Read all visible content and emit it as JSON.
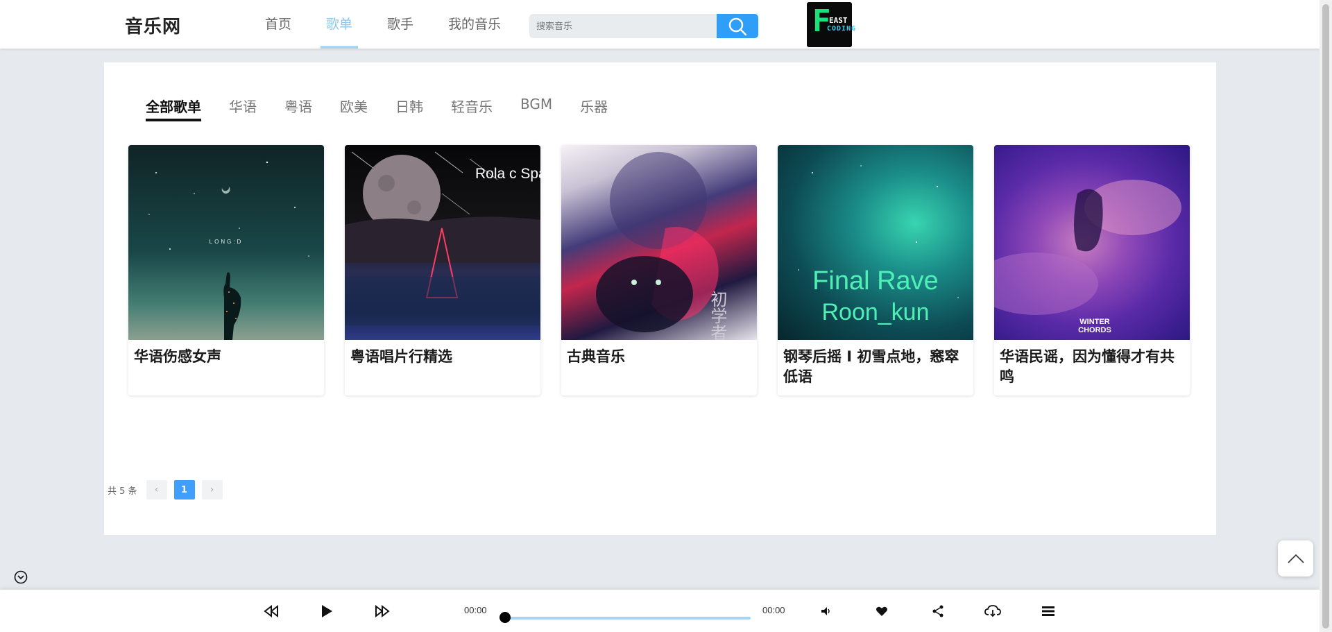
{
  "header": {
    "logo": "音乐网",
    "nav": [
      {
        "label": "首页"
      },
      {
        "label": "歌单",
        "active": true
      },
      {
        "label": "歌手"
      },
      {
        "label": "我的音乐"
      }
    ],
    "search_placeholder": "搜索音乐",
    "brand": {
      "f": "F",
      "east": "EAST",
      "coding": "CODING"
    }
  },
  "categories": [
    {
      "label": "全部歌单",
      "active": true
    },
    {
      "label": "华语"
    },
    {
      "label": "粤语"
    },
    {
      "label": "欧美"
    },
    {
      "label": "日韩"
    },
    {
      "label": "轻音乐"
    },
    {
      "label": "BGM"
    },
    {
      "label": "乐器"
    }
  ],
  "playlists": [
    {
      "title": "华语伤感女声",
      "cover_text": "LONG:D"
    },
    {
      "title": "粤语唱片行精选",
      "cover_text": "Rola c Space"
    },
    {
      "title": "古典音乐",
      "cover_text": "初学者"
    },
    {
      "title": "钢琴后摇 I 初雪点地，窸窣低语",
      "cover_text": "Final Rave Roon_kun"
    },
    {
      "title": "华语民谣，因为懂得才有共鸣",
      "cover_text": "WINTER CHORDS"
    }
  ],
  "pagination": {
    "total": "共 5 条",
    "current": "1"
  },
  "player": {
    "current_time": "00:00",
    "duration": "00:00",
    "progress": 0
  },
  "colors": {
    "accent": "#2e9ef8",
    "nav_active": "#8fc7ec",
    "page_active": "#409eff"
  }
}
